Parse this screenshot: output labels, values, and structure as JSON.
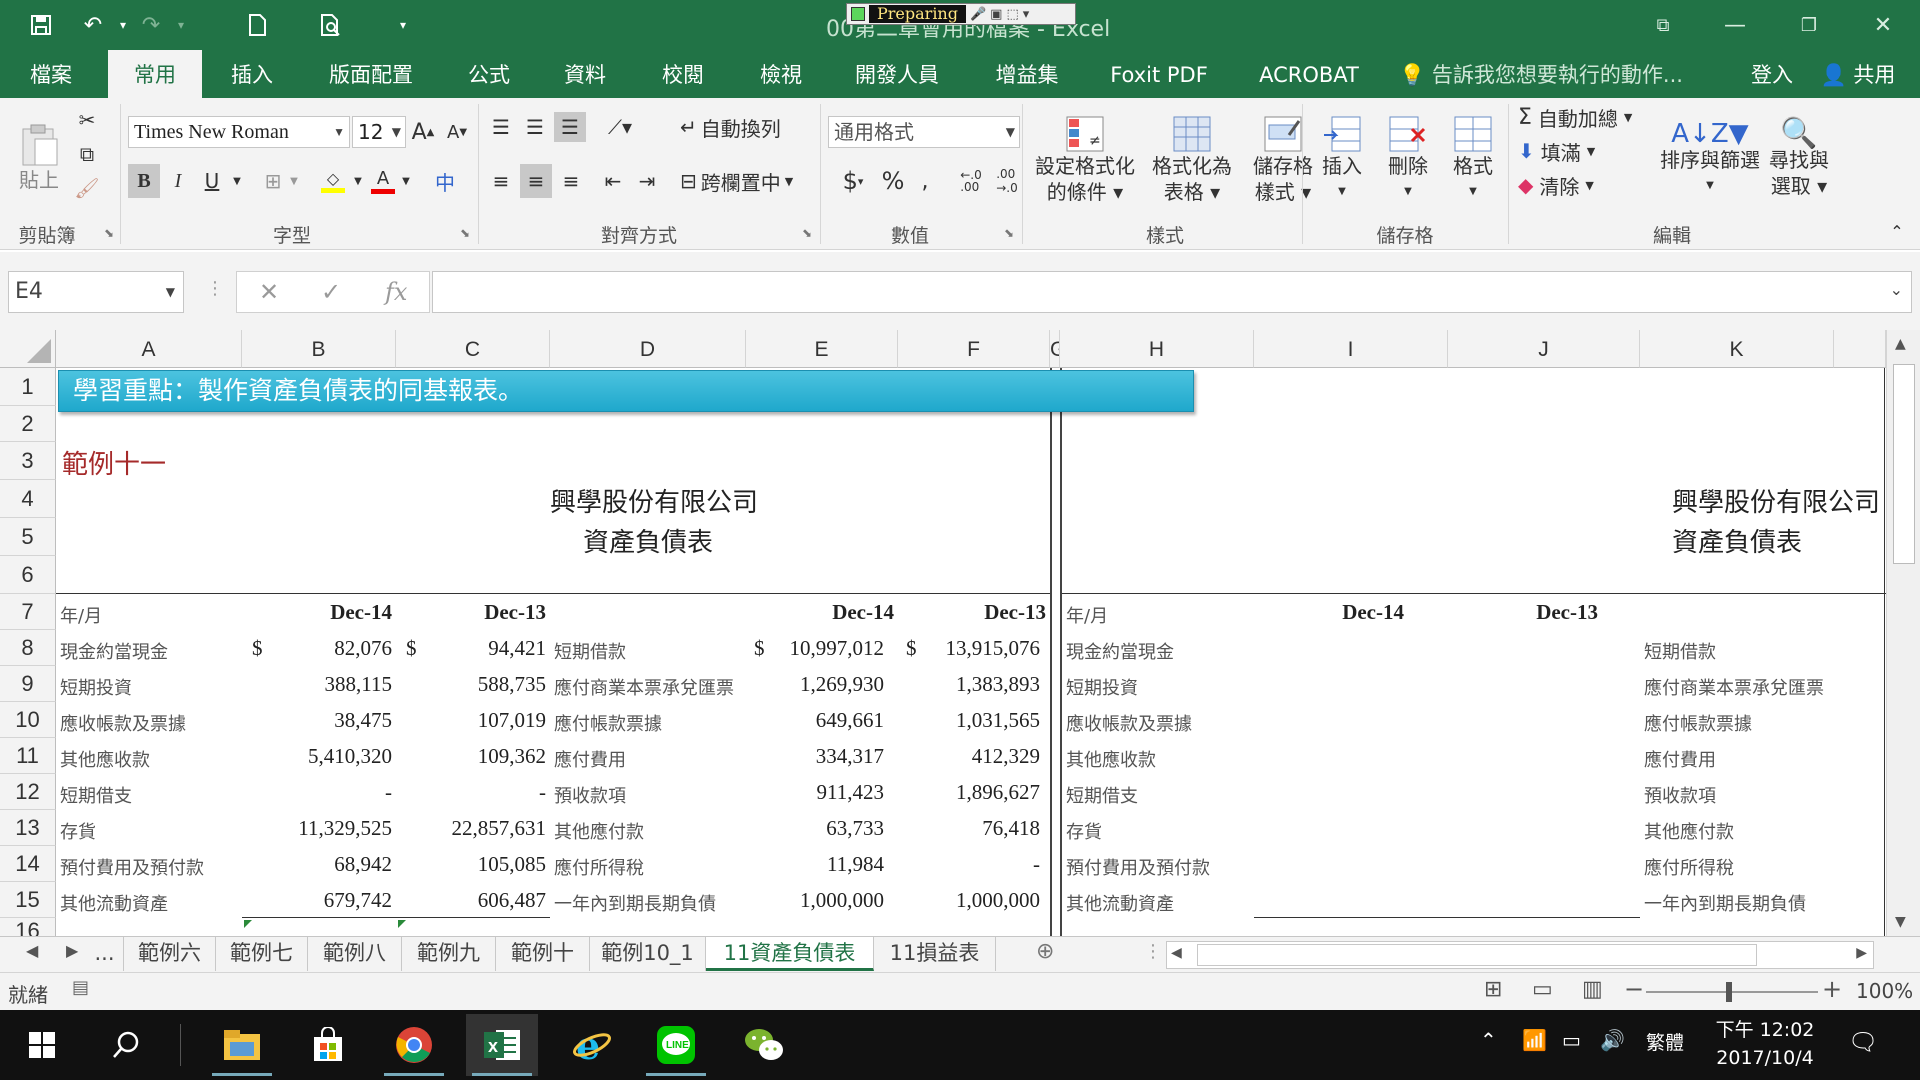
{
  "window": {
    "title": "00第二章會用的檔案 - Excel",
    "preparing_label": "Preparing"
  },
  "ribbon_tabs": [
    "檔案",
    "常用",
    "插入",
    "版面配置",
    "公式",
    "資料",
    "校閱",
    "檢視",
    "開發人員",
    "增益集",
    "Foxit PDF",
    "ACROBAT"
  ],
  "active_tab": "常用",
  "tell_me": "告訴我您想要執行的動作...",
  "signin": "登入",
  "share": "共用",
  "clipboard": {
    "paste": "貼上",
    "group": "剪貼簿"
  },
  "font": {
    "name": "Times New Roman",
    "size": "12",
    "bold": "B",
    "italic": "I",
    "underline": "U",
    "group": "字型"
  },
  "alignment": {
    "wrap": "自動換列",
    "merge": "跨欄置中",
    "group": "對齊方式"
  },
  "number": {
    "format": "通用格式",
    "group": "數值"
  },
  "styles": {
    "conditional": [
      "設定格式化",
      "的條件"
    ],
    "table": [
      "格式化為",
      "表格"
    ],
    "cell": [
      "儲存格",
      "樣式"
    ],
    "group": "樣式"
  },
  "cells": {
    "insert": "插入",
    "delete": "刪除",
    "format": "格式",
    "group": "儲存格"
  },
  "editing": {
    "autosum": "自動加總",
    "fill": "填滿",
    "clear": "清除",
    "sort": "排序與篩選",
    "find": [
      "尋找與",
      "選取"
    ],
    "group": "編輯"
  },
  "formula_bar": {
    "name_box": "E4",
    "fx": "fx",
    "formula": ""
  },
  "columns": [
    "A",
    "B",
    "C",
    "D",
    "E",
    "F",
    "G",
    "H",
    "I",
    "J",
    "K"
  ],
  "rows": [
    "1",
    "2",
    "3",
    "4",
    "5",
    "6",
    "7",
    "8",
    "9",
    "10",
    "11",
    "12",
    "13",
    "14",
    "15",
    "16"
  ],
  "sheet": {
    "banner": "學習重點：製作資產負債表的同基報表。",
    "example_title": "範例十一",
    "company": "興學股份有限公司",
    "statement": "資產負債表",
    "year_month": "年/月",
    "dates": [
      "Dec-14",
      "Dec-13"
    ],
    "currency": "$",
    "left_items": [
      "現金約當現金",
      "短期投資",
      "應收帳款及票據",
      "其他應收款",
      "短期借支",
      "存貨",
      "預付費用及預付款",
      "其他流動資產"
    ],
    "left_dec14": [
      "82,076",
      "388,115",
      "38,475",
      "5,410,320",
      "-",
      "11,329,525",
      "68,942",
      "679,742"
    ],
    "left_dec13": [
      "94,421",
      "588,735",
      "107,019",
      "109,362",
      "-",
      "22,857,631",
      "105,085",
      "606,487"
    ],
    "right_items": [
      "短期借款",
      "應付商業本票承兌匯票",
      "應付帳款票據",
      "應付費用",
      "預收款項",
      "其他應付款",
      "應付所得稅",
      "一年內到期長期負債"
    ],
    "right_dec14": [
      "10,997,012",
      "1,269,930",
      "649,661",
      "334,317",
      "911,423",
      "63,733",
      "11,984",
      "1,000,000"
    ],
    "right_dec13": [
      "13,915,076",
      "1,383,893",
      "1,031,565",
      "412,329",
      "1,896,627",
      "76,418",
      "-",
      "1,000,000"
    ],
    "right_liab_items_k": [
      "短期借款",
      "應付商業本票承兌匯票",
      "應付帳款票據",
      "應付費用",
      "預收款項",
      "其他應付款",
      "應付所得稅",
      "一年內到期長期負債"
    ]
  },
  "sheet_tabs": [
    "...",
    "範例六",
    "範例七",
    "範例八",
    "範例九",
    "範例十",
    "範例10_1",
    "11資產負債表",
    "11損益表"
  ],
  "active_sheet": "11資產負債表",
  "status": {
    "ready": "就緒",
    "zoom": "100%"
  },
  "taskbar": {
    "time": "下午 12:02",
    "date": "2017/10/4",
    "ime": "繁體"
  },
  "colors": {
    "excel_green": "#217346",
    "banner": "#2bb3d4",
    "example_title": "#a52a2a"
  }
}
